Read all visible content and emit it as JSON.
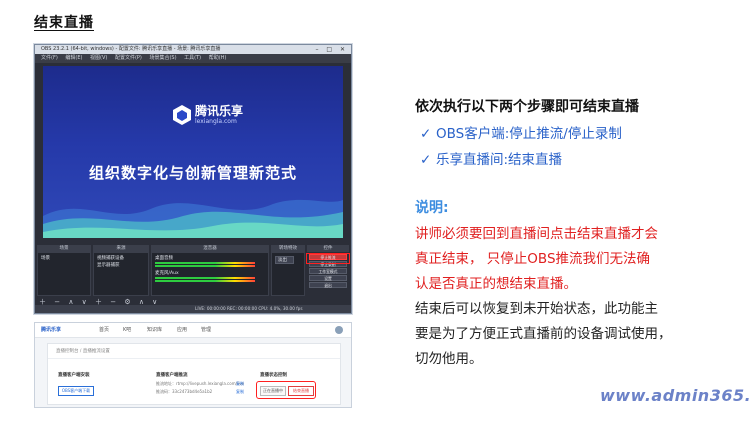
{
  "slide": {
    "title": "结束直播"
  },
  "obs": {
    "window_title": "OBS 23.2.1 (64-bit, windows) - 配置文件: 腾讯乐享直播 - 场景: 腾讯乐享直播",
    "menu": [
      "文件(F)",
      "编辑(E)",
      "视图(V)",
      "配置文件(P)",
      "场景集合(S)",
      "工具(T)",
      "帮助(H)"
    ],
    "preview": {
      "logo_text": "腾讯乐享",
      "logo_sub": "lexiangla.com",
      "slogan": "组织数字化与创新管理新范式"
    },
    "docks": {
      "scenes_title": "场景",
      "scenes": [
        "场景"
      ],
      "sources_title": "来源",
      "sources": [
        "视频捕获设备",
        "显示器捕获"
      ],
      "mixer_title": "混音器",
      "mixer_tracks": [
        "桌面音频",
        "麦克风/Aux"
      ],
      "transitions_title": "转场特效",
      "transition_value": "淡出",
      "controls_title": "控件",
      "controls": [
        "停止推流",
        "停止录制",
        "工作室模式",
        "设置",
        "退出"
      ]
    },
    "status": "LIVE: 00:00:00   REC: 00:00:00   CPU: 4.0%, 30.00 fps"
  },
  "web": {
    "brand": "腾讯乐享",
    "nav": [
      "首页",
      "K吧",
      "知识库",
      "应用",
      "管理"
    ],
    "breadcrumb": "直播控制台 / 直播推流设置",
    "pusher_label": "直播客户端安装",
    "pusher_button": "OBS客户端下载",
    "push_addr_label": "直播客户端推流",
    "push_url": "推流地址：rtmp://livepush.lexiangla.com/live",
    "push_key": "推流码：33c2473bd4e5a1b2",
    "copy_label": "复制",
    "status_label": "直播状态控制",
    "working_button": "正在直播中",
    "end_button": "结束直播"
  },
  "steps": {
    "heading": "依次执行以下两个步骤即可结束直播",
    "items": [
      "OBS客户端:停止推流/停止录制",
      "乐享直播间:结束直播"
    ]
  },
  "note": {
    "label": "说明:",
    "red_lines": [
      "讲师必须要回到直播间点击结束直播才会",
      "真正结束，  只停止OBS推流我们无法确",
      "认是否真正的想结束直播。"
    ],
    "dark_lines": [
      "结束后可以恢复到未开始状态，此功能主",
      "要是为了方便正式直播前的设备调试使用，",
      "切勿他用。"
    ]
  },
  "watermark": "www.admin365.cn",
  "colors": {
    "step_blue": "#2a62c9",
    "note_red": "#e02020",
    "note_label_blue": "#3d8de0",
    "preview_blue": "#2539a9"
  }
}
